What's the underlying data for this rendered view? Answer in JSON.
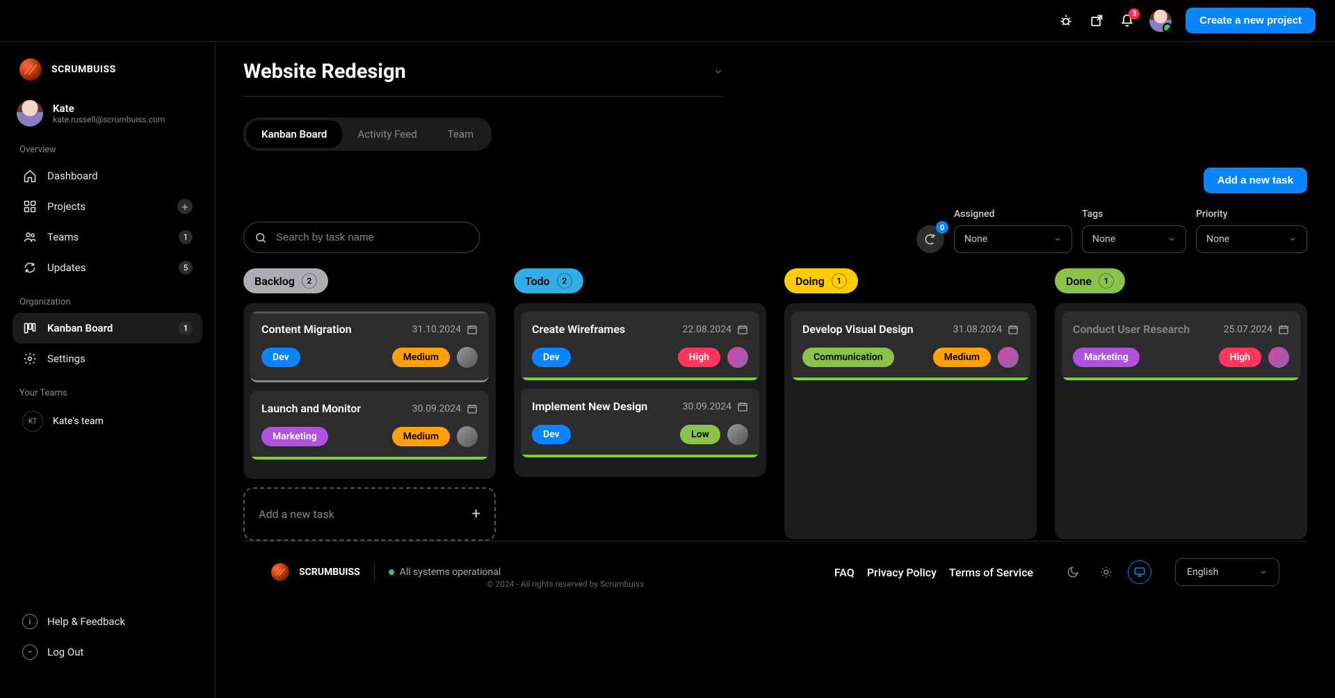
{
  "topbar": {
    "notification_count": "3",
    "create_project_label": "Create a new project"
  },
  "brand": {
    "name": "SCRUMBUISS"
  },
  "user": {
    "name": "Kate",
    "email": "kate.russell@scrumbuiss.com"
  },
  "sections": {
    "overview": "Overview",
    "organization": "Organization",
    "your_teams": "Your Teams"
  },
  "nav": {
    "dashboard": "Dashboard",
    "projects": "Projects",
    "teams": "Teams",
    "teams_count": "1",
    "updates": "Updates",
    "updates_count": "5",
    "kanban": "Kanban Board",
    "kanban_count": "1",
    "settings": "Settings"
  },
  "team": {
    "badge": "KT",
    "name": "Kate's team"
  },
  "sidebar_bottom": {
    "help": "Help & Feedback",
    "logout": "Log Out"
  },
  "project": {
    "title": "Website Redesign"
  },
  "tabs": {
    "kanban": "Kanban Board",
    "activity": "Activity Feed",
    "team": "Team"
  },
  "actions": {
    "add_task": "Add a new task",
    "add_task_card": "Add a new task"
  },
  "search": {
    "placeholder": "Search by task name"
  },
  "refresh": {
    "count": "0"
  },
  "filters": {
    "assigned_label": "Assigned",
    "assigned_value": "None",
    "tags_label": "Tags",
    "tags_value": "None",
    "priority_label": "Priority",
    "priority_value": "None"
  },
  "columns": {
    "backlog": {
      "label": "Backlog",
      "count": "2"
    },
    "todo": {
      "label": "Todo",
      "count": "2"
    },
    "doing": {
      "label": "Doing",
      "count": "1"
    },
    "done": {
      "label": "Done",
      "count": "1"
    }
  },
  "cards": {
    "c1": {
      "title": "Content Migration",
      "date": "31.10.2024",
      "tag": "Dev",
      "priority": "Medium"
    },
    "c2": {
      "title": "Launch and Monitor",
      "date": "30.09.2024",
      "tag": "Marketing",
      "priority": "Medium"
    },
    "c3": {
      "title": "Create Wireframes",
      "date": "22.08.2024",
      "tag": "Dev",
      "priority": "High"
    },
    "c4": {
      "title": "Implement New Design",
      "date": "30.09.2024",
      "tag": "Dev",
      "priority": "Low"
    },
    "c5": {
      "title": "Develop Visual Design",
      "date": "31.08.2024",
      "tag": "Communication",
      "priority": "Medium"
    },
    "c6": {
      "title": "Conduct User Research",
      "date": "25.07.2024",
      "tag": "Marketing",
      "priority": "High"
    }
  },
  "footer": {
    "brand": "SCRUMBUISS",
    "status": "All systems operational",
    "faq": "FAQ",
    "privacy": "Privacy Policy",
    "terms": "Terms of Service",
    "language": "English",
    "copyright": "© 2024 - All rights reserved by Scrumbuiss"
  }
}
